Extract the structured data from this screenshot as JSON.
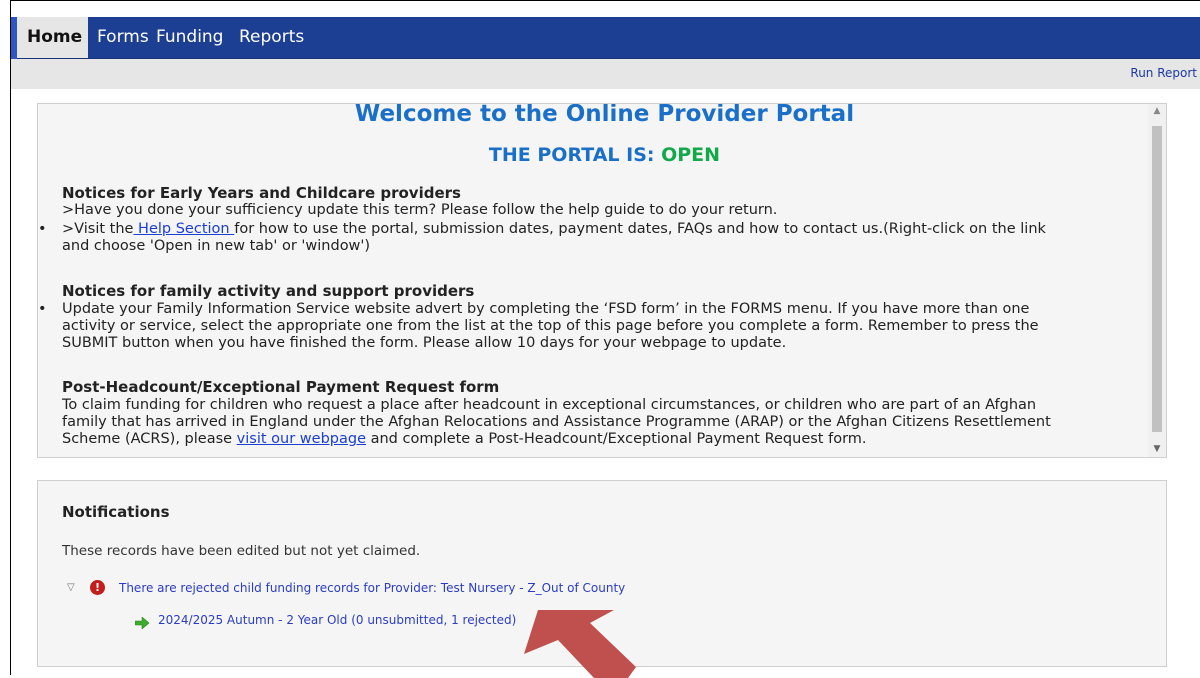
{
  "nav": {
    "home": "Home",
    "forms": "Forms",
    "funding": "Funding",
    "reports": "Reports"
  },
  "toolbar": {
    "run_report": "Run Report"
  },
  "welcome": {
    "title": "Welcome to the Online Provider Portal",
    "status_prefix": "THE PORTAL IS: ",
    "status_value": "OPEN",
    "section1": {
      "heading": "Notices for Early Years and Childcare providers",
      "line1": ">Have you done your sufficiency update this term? Please follow the help guide to do your return.",
      "line2_pre": ">Visit the",
      "line2_link": " Help Section ",
      "line2_post": "for how to use the portal, submission dates, payment dates, FAQs and how to contact us.(Right-click on the link",
      "line3": "and choose 'Open in new tab' or 'window')"
    },
    "section2": {
      "heading": "Notices for family activity and support providers",
      "line1": "Update your Family Information Service website advert by completing the ‘FSD form’ in the FORMS menu. If you have more than one",
      "line2": "activity or service, select the appropriate one from the list at the top of this page before you complete a form. Remember to press the",
      "line3": "SUBMIT button when you have finished the form. Please allow 10 days for your webpage to update."
    },
    "section3": {
      "heading": "Post-Headcount/Exceptional Payment Request form",
      "line1": "To claim funding for children who request a place after headcount in exceptional circumstances, or children who are part of an Afghan",
      "line2": "family that has arrived in England under the Afghan Relocations and Assistance Programme (ARAP) or the Afghan Citizens Resettlement",
      "line3_pre": "Scheme (ACRS), please ",
      "line3_link": "visit our webpage",
      "line3_post": " and complete a Post-Headcount/Exceptional Payment Request form."
    }
  },
  "notifications": {
    "title": "Notifications",
    "description": "These records have been edited but not yet claimed.",
    "error_icon_glyph": "!",
    "item": "There are rejected child funding records for Provider: Test Nursery - Z_Out of County",
    "subitem": "2024/2025 Autumn - 2 Year Old (0 unsubmitted, 1 rejected)"
  },
  "colors": {
    "nav_bg": "#1c3f94",
    "title_blue": "#1a6fc9",
    "open_green": "#13a84a",
    "link_blue": "#2a3dc4",
    "arrow_red": "#c0504d"
  }
}
